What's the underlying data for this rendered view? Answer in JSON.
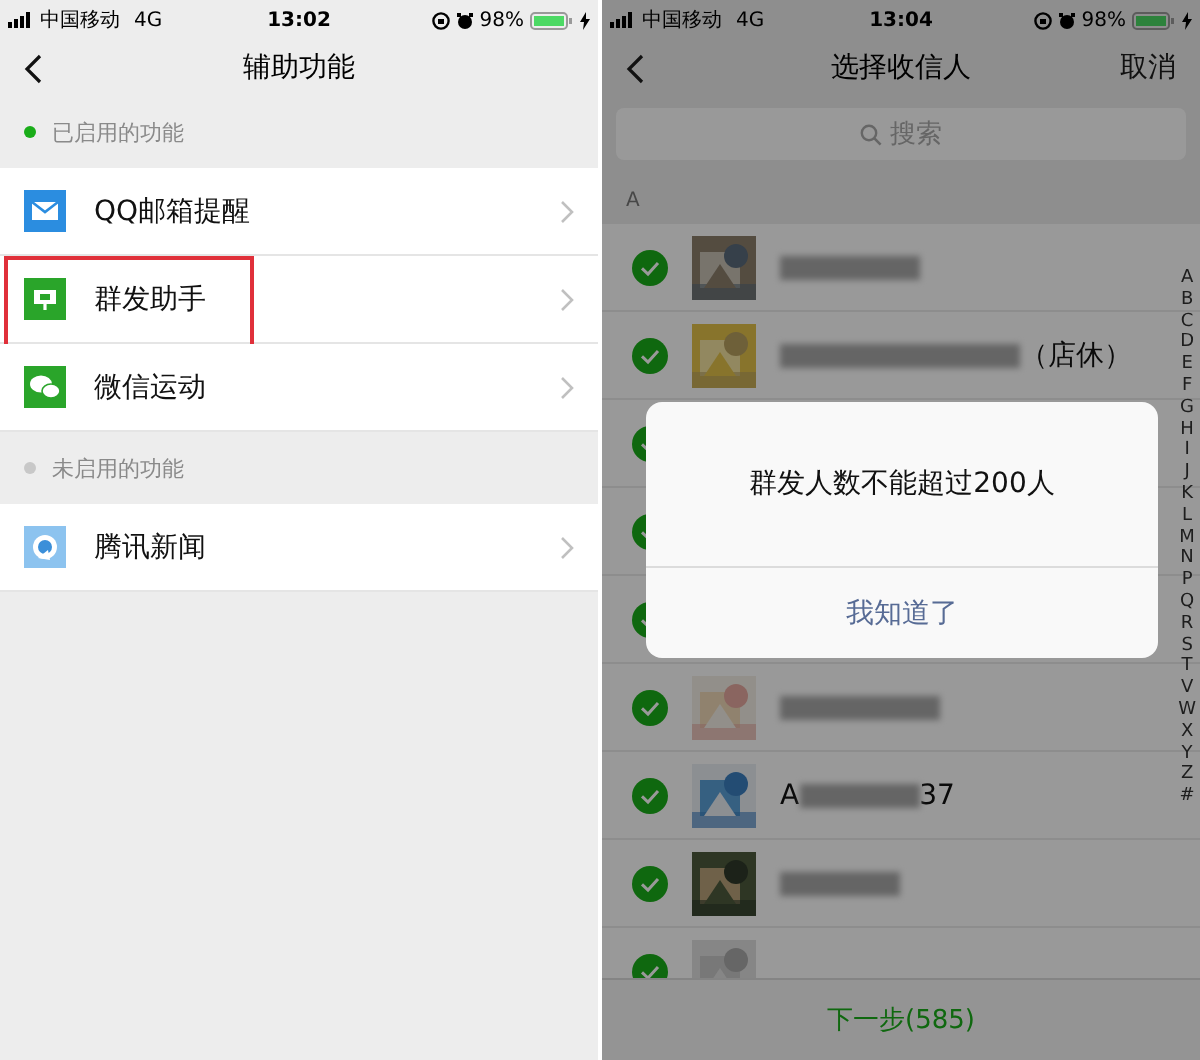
{
  "left": {
    "status_bar": {
      "carrier": "中国移动",
      "network": "4G",
      "time": "13:02",
      "battery": "98%"
    },
    "nav": {
      "title": "辅助功能"
    },
    "sections": [
      {
        "title": "已启用的功能",
        "enabled": true,
        "items": [
          {
            "label": "QQ邮箱提醒",
            "highlighted": false
          },
          {
            "label": "群发助手",
            "highlighted": true
          },
          {
            "label": "微信运动",
            "highlighted": false
          }
        ]
      },
      {
        "title": "未启用的功能",
        "enabled": false,
        "items": [
          {
            "label": "腾讯新闻",
            "highlighted": false
          }
        ]
      }
    ]
  },
  "right": {
    "status_bar": {
      "carrier": "中国移动",
      "network": "4G",
      "time": "13:04",
      "battery": "98%"
    },
    "nav": {
      "title": "选择收信人",
      "action": "取消"
    },
    "search": {
      "placeholder": "搜索"
    },
    "index_header": "A",
    "contacts": [
      {
        "checked": true,
        "name_parts": [
          {
            "kind": "redacted"
          }
        ]
      },
      {
        "checked": true,
        "name_parts": [
          {
            "kind": "redacted"
          },
          {
            "kind": "text",
            "text": "（店休）"
          }
        ]
      },
      {
        "checked": true,
        "avatar": false
      },
      {
        "checked": true,
        "avatar": false
      },
      {
        "checked": true,
        "avatar": false
      },
      {
        "checked": true,
        "name_parts": [
          {
            "kind": "redacted"
          }
        ]
      },
      {
        "checked": true,
        "name_parts": [
          {
            "kind": "text",
            "text": "A"
          },
          {
            "kind": "redacted"
          },
          {
            "kind": "text",
            "text": "37"
          }
        ]
      },
      {
        "checked": true,
        "name_parts": [
          {
            "kind": "redacted"
          }
        ]
      },
      {
        "checked": true
      }
    ],
    "alphabet": [
      "A",
      "B",
      "C",
      "D",
      "E",
      "F",
      "G",
      "H",
      "I",
      "J",
      "K",
      "L",
      "M",
      "N",
      "P",
      "Q",
      "R",
      "S",
      "T",
      "V",
      "W",
      "X",
      "Y",
      "Z",
      "#"
    ],
    "next_button": "下一步(585)",
    "dialog": {
      "message": "群发人数不能超过200人",
      "button": "我知道了"
    }
  }
}
